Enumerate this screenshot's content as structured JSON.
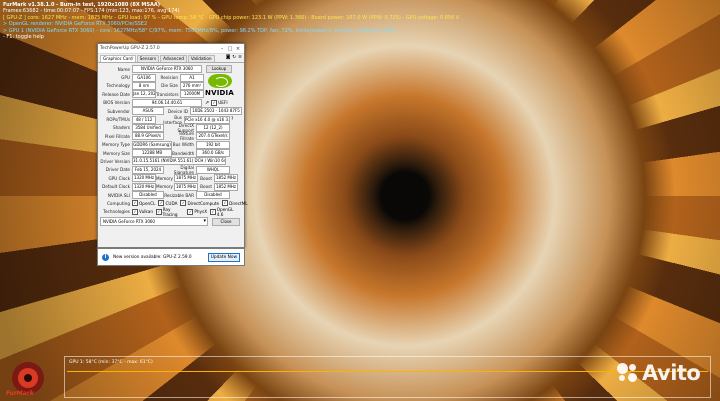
{
  "overlay": {
    "title": "FurMark v1.38.1.0 - Burn-in test, 1920x1080 (8X MSAA)",
    "line1": "Frames:63682 - time:00:07:07 - FPS:174 (min:123, max:176, avg:174)",
    "line2": "[ GPU-Z ] core: 1627 MHz - mem: 1875 MHz - GPU load: 97 % - GPU temp: 58 °C - GPU chip power: 123.1 W (PPW: 1.366) - Board power: 167.0 W (PPW: 0.725) - GPU voltage: 0.856 V",
    "line3": "> OpenGL renderer: NVIDIA GeForce RTX 3060/PCIe/SSE2",
    "line4": "> GPU 1 (NVIDIA GeForce RTX 3060) - core: 1627MHz/58° C/97%, mem: 7500MHz/8%, power: 98.2% TDP, fan: 72%, limits(power:1, temp:0, voltage:0, OV:0)",
    "line5": "- F1: toggle help"
  },
  "window": {
    "title": "TechPowerUp GPU-Z 2.57.0",
    "tabs": [
      "Graphics Card",
      "Sensors",
      "Advanced",
      "Validation"
    ],
    "name_label": "Name",
    "name": "NVIDIA GeForce RTX 3060",
    "lookup": "Lookup",
    "gpu_label": "GPU",
    "gpu": "GA106",
    "revision_label": "Revision",
    "revision": "A1",
    "tech_label": "Technology",
    "tech": "8 nm",
    "diesize_label": "Die Size",
    "diesize": "276 mm²",
    "release_label": "Release Date",
    "release": "Jan 12, 2021",
    "transistors_label": "Transistors",
    "transistors": "12000M",
    "bios_label": "BIOS Version",
    "bios": "94.06.14.40.61",
    "uefi": "UEFI",
    "subvendor_label": "Subvendor",
    "subvendor": "ASUS",
    "deviceid_label": "Device ID",
    "deviceid": "10DE 2503 - 1043 87F5",
    "rops_label": "ROPs/TMUs",
    "rops": "48 / 112",
    "bus_label": "Bus Interface",
    "bus": "PCIe x16 4.0 @ x16 3.0",
    "shaders_label": "Shaders",
    "shaders": "3584 Unified",
    "directx_label": "DirectX Support",
    "directx": "12 (12_2)",
    "pixel_label": "Pixel Fillrate",
    "pixel": "88.9 GPixel/s",
    "texture_label": "Texture Fillrate",
    "texture": "207.4 GTexel/s",
    "memtype_label": "Memory Type",
    "memtype": "GDDR6 (Samsung)",
    "buswidth_label": "Bus Width",
    "buswidth": "192 bit",
    "memsize_label": "Memory Size",
    "memsize": "12288 MB",
    "bandwidth_label": "Bandwidth",
    "bandwidth": "360.0 GB/s",
    "driver_label": "Driver Version",
    "driver": "31.0.15.5161 (NVIDIA 551.61) DCH / Win10 64",
    "driverdate_label": "Driver Date",
    "driverdate": "Feb 15, 2024",
    "digsig_label": "Digital Signature",
    "digsig": "WHQL",
    "gpuclock_label": "GPU Clock",
    "gpuclock": "1320 MHz",
    "memory_label": "Memory",
    "memclock": "1875 MHz",
    "boost_label": "Boost",
    "boost": "1852 MHz",
    "defclock_label": "Default Clock",
    "defclock": "1320 MHz",
    "defmem": "1875 MHz",
    "defboost": "1852 MHz",
    "sli_label": "NVIDIA SLI",
    "sli": "Disabled",
    "rebar_label": "Resizable BAR",
    "rebar": "Disabled",
    "computing_label": "Computing",
    "computing": [
      "OpenCL",
      "CUDA",
      "DirectCompute",
      "DirectML"
    ],
    "technologies_label": "Technologies",
    "technologies": [
      "Vulkan",
      "Ray Tracing",
      "PhysX",
      "OpenGL 4.6"
    ],
    "selected_gpu": "NVIDIA GeForce RTX 3060",
    "close": "Close",
    "nvidia_logo_text": "NVIDIA"
  },
  "notice": {
    "text": "New version available: GPU-Z 2.59.0",
    "button": "Update Now"
  },
  "graph": {
    "label": "GPU 1: 58°C (min: 37°C - max: 61°C)"
  },
  "furmark_logo": "FurMark",
  "watermark": "Avito"
}
